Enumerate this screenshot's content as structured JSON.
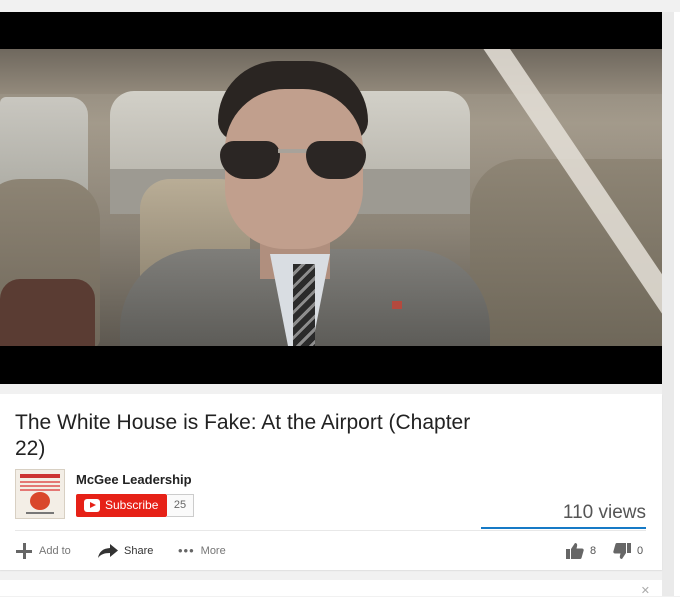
{
  "video": {
    "title": "The White House is Fake: At the Airport (Chapter 22)"
  },
  "channel": {
    "name": "McGee Leadership",
    "subscribe_label": "Subscribe",
    "subscriber_count": "25"
  },
  "stats": {
    "views": "110 views",
    "likes": "8",
    "dislikes": "0",
    "like_ratio": 1.0
  },
  "actions": {
    "add_to": "Add to",
    "share": "Share",
    "more": "More"
  },
  "colors": {
    "subscribe_red": "#e62117",
    "sentiment_blue": "#167ac6"
  },
  "icons": {
    "add": "plus-icon",
    "share": "share-arrow-icon",
    "more": "more-dots-icon",
    "like": "thumbs-up-icon",
    "dislike": "thumbs-down-icon",
    "subscribe": "youtube-play-icon",
    "close": "close-icon"
  }
}
